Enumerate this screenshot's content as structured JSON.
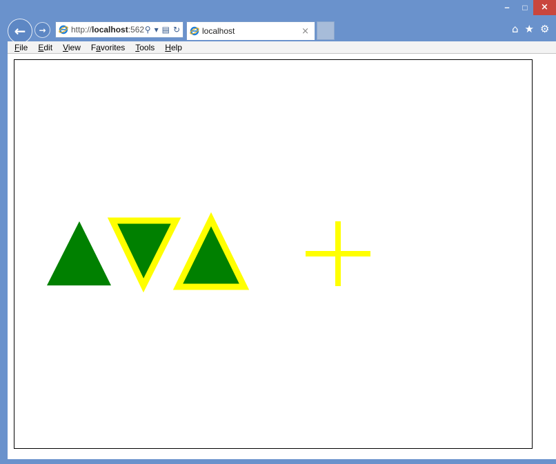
{
  "window": {
    "minimize_glyph": "–",
    "maximize_glyph": "□",
    "close_glyph": "×"
  },
  "toolbar": {
    "back_glyph": "←",
    "forward_glyph": "→",
    "address_prefix": "http://",
    "address_host": "localhost",
    "address_rest": ":562",
    "search_glyph": "⚲",
    "dropdown_glyph": "▾",
    "compat_glyph": "▤",
    "refresh_glyph": "↻",
    "home_glyph": "⌂",
    "favorites_glyph": "★",
    "tools_glyph": "⚙"
  },
  "tab": {
    "title": "localhost",
    "close_glyph": "×"
  },
  "menu": [
    {
      "key": "F",
      "rest": "ile"
    },
    {
      "key": "E",
      "rest": "dit"
    },
    {
      "key": "V",
      "rest": "iew"
    },
    {
      "key": "F",
      "rest": "avorites",
      "prefix": "F",
      "underline": "a",
      "suffix": "vorites"
    },
    {
      "key": "T",
      "rest": "ools"
    },
    {
      "key": "H",
      "rest": "elp"
    }
  ],
  "colors": {
    "frame": "#6a92cc",
    "shape_fill": "#008000",
    "shape_stroke": "#ffff00",
    "close_button": "#c9463d"
  },
  "shapes": [
    {
      "kind": "triangle-up",
      "fill": "green",
      "stroke": "none"
    },
    {
      "kind": "triangle-down",
      "fill": "green",
      "stroke": "yellow"
    },
    {
      "kind": "triangle-up",
      "fill": "green",
      "stroke": "yellow"
    },
    {
      "kind": "plus",
      "fill": "none",
      "stroke": "yellow"
    }
  ]
}
